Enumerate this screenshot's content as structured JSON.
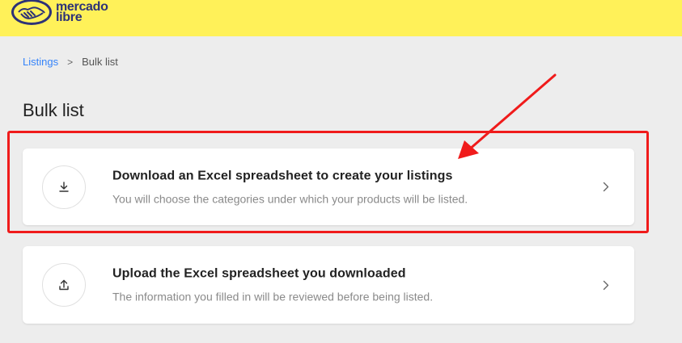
{
  "header": {
    "logo_text_line1": "mercado",
    "logo_text_line2": "libre"
  },
  "breadcrumb": {
    "link_label": "Listings",
    "separator": ">",
    "current_label": "Bulk list"
  },
  "page": {
    "title": "Bulk list"
  },
  "cards": [
    {
      "title": "Download an Excel spreadsheet to create your listings",
      "subtitle": "You will choose the categories under which your products will be listed.",
      "icon": "download-icon"
    },
    {
      "title": "Upload the Excel spreadsheet you downloaded",
      "subtitle": "The information you filled in will be reviewed before being listed.",
      "icon": "upload-icon"
    }
  ],
  "colors": {
    "header_bg": "#fff159",
    "brand_blue": "#2d3277",
    "link_blue": "#3483fa",
    "annotation_red": "#f01b1b",
    "page_bg": "#ededed"
  }
}
